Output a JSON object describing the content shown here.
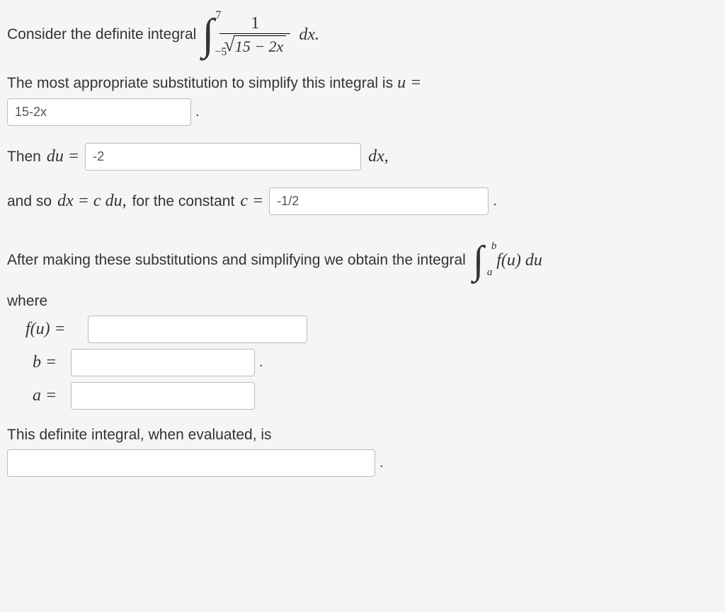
{
  "line1_prefix": "Consider the definite integral",
  "integral1": {
    "upper": "7",
    "lower": "−5",
    "numerator": "1",
    "radicand": "15 − 2x",
    "dx": "dx."
  },
  "line2": "The most appropriate substitution to simplify this integral is",
  "u_eq": "u =",
  "inputs": {
    "u": "15-2x",
    "du": "-2",
    "c": "-1/2",
    "fu": "",
    "b": "",
    "a": "",
    "result": ""
  },
  "then": "Then",
  "du_eq": "du =",
  "dx_comma": "dx,",
  "and_so": "and so",
  "dx_eq_cdu": "dx = c du,",
  "for_constant": "for the constant",
  "c_eq": "c =",
  "after_subs": "After making these substitutions and simplifying we obtain the integral",
  "integral2": {
    "upper": "b",
    "lower": "a",
    "body": "f(u) du"
  },
  "where": "where",
  "fu_eq": "f(u) =",
  "b_eq": "b =",
  "a_eq": "a =",
  "final_line": "This definite integral, when evaluated, is",
  "period": "."
}
